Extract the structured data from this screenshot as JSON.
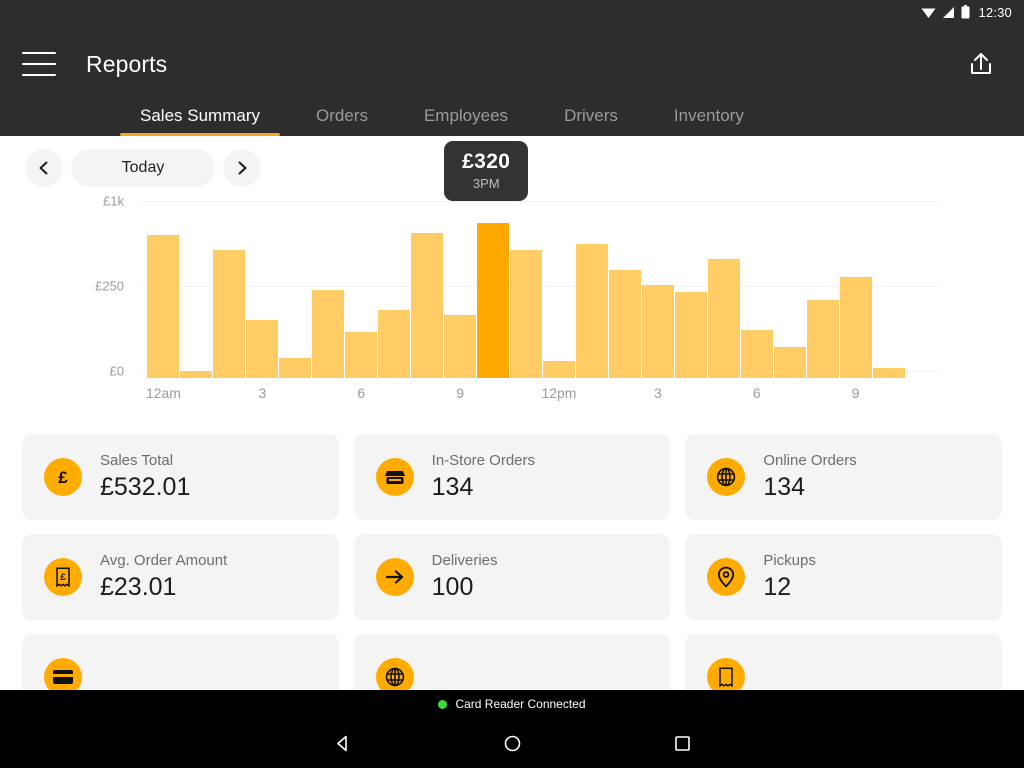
{
  "status_bar": {
    "time": "12:30",
    "icons": [
      "wifi-icon",
      "cellular-signal-icon",
      "battery-icon"
    ]
  },
  "app_bar": {
    "title": "Reports",
    "menu_icon": "hamburger-menu-icon",
    "share_icon": "share-upload-icon"
  },
  "tabs": [
    {
      "label": "Sales Summary",
      "active": true
    },
    {
      "label": "Orders",
      "active": false
    },
    {
      "label": "Employees",
      "active": false
    },
    {
      "label": "Drivers",
      "active": false
    },
    {
      "label": "Inventory",
      "active": false
    }
  ],
  "date_nav": {
    "prev_icon": "chevron-left-icon",
    "next_icon": "chevron-right-icon",
    "current": "Today"
  },
  "tooltip": {
    "value": "£320",
    "time": "3PM"
  },
  "chart_data": {
    "type": "bar",
    "title": "",
    "xlabel": "",
    "ylabel": "",
    "grid": true,
    "legend": null,
    "ytick_labels": [
      "£1k",
      "£250",
      "£0"
    ],
    "ytick_values": [
      1000,
      250,
      0
    ],
    "ylim": [
      0,
      1000
    ],
    "xtick_labels": [
      "12am",
      "3",
      "6",
      "9",
      "12pm",
      "3",
      "6",
      "9"
    ],
    "xtick_indices": [
      0,
      3,
      6,
      9,
      12,
      15,
      18,
      21
    ],
    "categories": [
      "12am",
      "1am",
      "2am",
      "3am",
      "4am",
      "5am",
      "6am",
      "7am",
      "8am",
      "9am",
      "10am",
      "11am",
      "12pm",
      "1pm",
      "2pm",
      "3pm",
      "4pm",
      "5pm",
      "6pm",
      "7pm",
      "8pm",
      "9pm",
      "10pm",
      "11pm"
    ],
    "values": [
      760,
      20,
      630,
      170,
      60,
      275,
      135,
      200,
      780,
      185,
      870,
      630,
      50,
      680,
      450,
      320,
      260,
      550,
      140,
      90,
      230,
      390,
      30,
      0
    ],
    "highlight_index": 10,
    "bar_color": "#ffcc66",
    "highlight_color": "#ffa800"
  },
  "cards": [
    {
      "label": "Sales Total",
      "value": "£532.01",
      "icon": "pound-sign-icon"
    },
    {
      "label": "In-Store Orders",
      "value": "134",
      "icon": "storefront-icon"
    },
    {
      "label": "Online Orders",
      "value": "134",
      "icon": "globe-icon"
    },
    {
      "label": "Avg. Order Amount",
      "value": "£23.01",
      "icon": "receipt-pound-icon"
    },
    {
      "label": "Deliveries",
      "value": "100",
      "icon": "arrow-right-icon"
    },
    {
      "label": "Pickups",
      "value": "12",
      "icon": "location-pin-icon"
    }
  ],
  "partial_cards": [
    {
      "icon": "card-icon"
    },
    {
      "icon": "globe-icon"
    },
    {
      "icon": "receipt-icon"
    }
  ],
  "system": {
    "card_reader_status": "Card Reader Connected",
    "status_color": "#3ddc3d",
    "nav_keys": [
      "back-nav-button",
      "home-nav-button",
      "recents-nav-button"
    ]
  },
  "colors": {
    "brand_orange": "#ffab00",
    "tab_underline": "#f5a623",
    "appbar_bg": "#2d2d2d",
    "card_bg": "#f4f4f4"
  }
}
